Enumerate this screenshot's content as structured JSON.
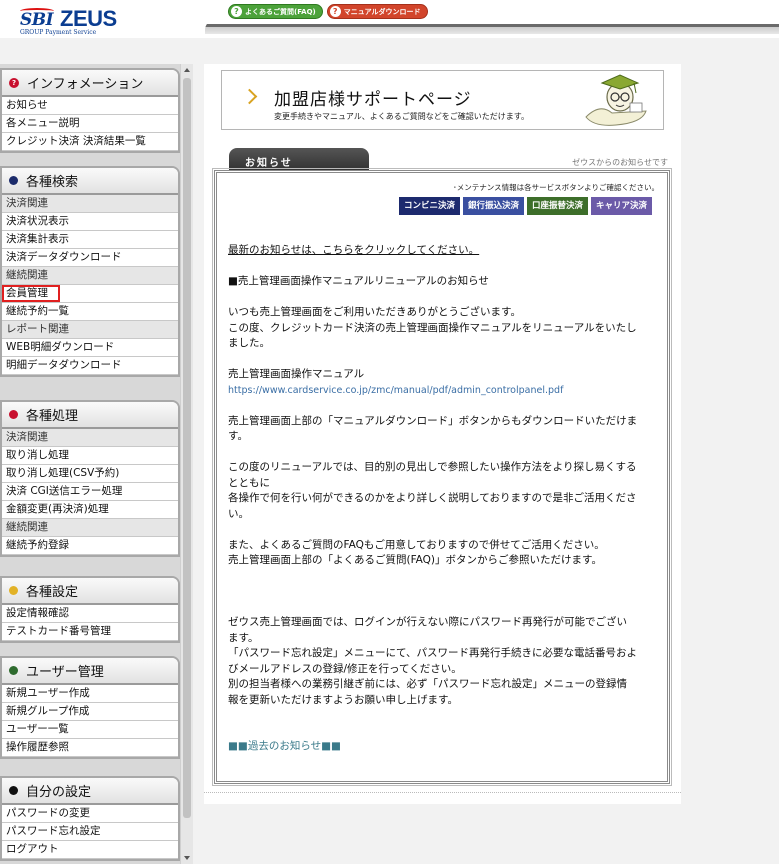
{
  "header": {
    "logo_sbi": "SBI",
    "logo_zeus": "ZEUS",
    "logo_sub": "GROUP  Payment Service",
    "faq_button": "よくあるご質問(FAQ)",
    "manual_button": "マニュアルダウンロード"
  },
  "sidebar": {
    "panels": [
      {
        "title": "インフォメーション",
        "icon": "info-icon",
        "items": [
          {
            "label": "お知らせ",
            "type": "link"
          },
          {
            "label": "各メニュー説明",
            "type": "link"
          },
          {
            "label": "クレジット決済 決済結果一覧",
            "type": "link"
          }
        ]
      },
      {
        "title": "各種検索",
        "icon": "navy-dot",
        "items": [
          {
            "label": "決済関連",
            "type": "category"
          },
          {
            "label": "決済状況表示",
            "type": "link"
          },
          {
            "label": "決済集計表示",
            "type": "link"
          },
          {
            "label": "決済データダウンロード",
            "type": "link"
          },
          {
            "label": "継続関連",
            "type": "category"
          },
          {
            "label": "会員管理",
            "type": "link",
            "highlighted": true
          },
          {
            "label": "継続予約一覧",
            "type": "link"
          },
          {
            "label": "レポート関連",
            "type": "category"
          },
          {
            "label": "WEB明細ダウンロード",
            "type": "link"
          },
          {
            "label": "明細データダウンロード",
            "type": "link"
          }
        ]
      },
      {
        "title": "各種処理",
        "icon": "red-dot",
        "items": [
          {
            "label": "決済関連",
            "type": "category"
          },
          {
            "label": "取り消し処理",
            "type": "link"
          },
          {
            "label": "取り消し処理(CSV予約)",
            "type": "link"
          },
          {
            "label": "決済 CGI送信エラー処理",
            "type": "link"
          },
          {
            "label": "金額変更(再決済)処理",
            "type": "link"
          },
          {
            "label": "継続関連",
            "type": "category"
          },
          {
            "label": "継続予約登録",
            "type": "link"
          }
        ]
      },
      {
        "title": "各種設定",
        "icon": "yellow-dot",
        "items": [
          {
            "label": "設定情報確認",
            "type": "link"
          },
          {
            "label": "テストカード番号管理",
            "type": "link"
          }
        ]
      },
      {
        "title": "ユーザー管理",
        "icon": "green-dot",
        "items": [
          {
            "label": "新規ユーザー作成",
            "type": "link"
          },
          {
            "label": "新規グループ作成",
            "type": "link"
          },
          {
            "label": "ユーザー一覧",
            "type": "link"
          },
          {
            "label": "操作履歴参照",
            "type": "link"
          }
        ]
      },
      {
        "title": "自分の設定",
        "icon": "black-dot",
        "items": [
          {
            "label": "パスワードの変更",
            "type": "link"
          },
          {
            "label": "パスワード忘れ設定",
            "type": "link"
          },
          {
            "label": "ログアウト",
            "type": "link"
          }
        ]
      }
    ]
  },
  "main": {
    "banner_title": "加盟店様サポートページ",
    "banner_subtitle": "変更手続きやマニュアル、よくあるご質問などをご確認いただけます。",
    "tab_label": "お知らせ",
    "tab_note": "ゼウスからのお知らせです",
    "maintenance_note": "･メンテナンス情報は各サービスボタンよりご確認ください。",
    "service_buttons": [
      "コンビニ決済",
      "銀行振込決済",
      "口座振替決済",
      "キャリア決済"
    ],
    "latest_link": "最新のお知らせは、こちらをクリックしてください。",
    "notice_heading": "■売上管理画面操作マニュアルリニューアルのお知らせ",
    "p1_l1": "いつも売上管理画面をご利用いただきありがとうございます。",
    "p1_l2": "この度、クレジットカード決済の売上管理画面操作マニュアルをリニューアルをいたし",
    "p1_l3": "ました。",
    "manual_label": "売上管理画面操作マニュアル",
    "manual_url": "https://www.cardservice.co.jp/zmc/manual/pdf/admin_controlpanel.pdf",
    "p2_l1": "売上管理画面上部の「マニュアルダウンロード」ボタンからもダウンロードいただけま",
    "p2_l2": "す。",
    "p3_l1": "この度のリニューアルでは、目的別の見出しで参照したい操作方法をより探し易くする",
    "p3_l2": "とともに",
    "p3_l3": "各操作で何を行い何ができるのかをより詳しく説明しておりますので是非ご活用くださ",
    "p3_l4": "い。",
    "p4_l1": "また、よくあるご質問のFAQもご用意しておりますので併せてご活用ください。",
    "p4_l2": "売上管理画面上部の「よくあるご質問(FAQ)」ボタンからご参照いただけます。",
    "p5_l1": "ゼウス売上管理画面では、ログインが行えない際にパスワード再発行が可能でござい",
    "p5_l2": "ます。",
    "p5_l3": "「パスワード忘れ設定」メニューにて、パスワード再発行手続きに必要な電話番号およ",
    "p5_l4": "びメールアドレスの登録/修正を行ってください。",
    "p5_l5": "別の担当者様への業務引継ぎ前には、必ず「パスワード忘れ設定」メニューの登録情",
    "p5_l6": "報を更新いただけますようお願い申し上げます。",
    "past_link": "■■過去のお知らせ■■"
  }
}
